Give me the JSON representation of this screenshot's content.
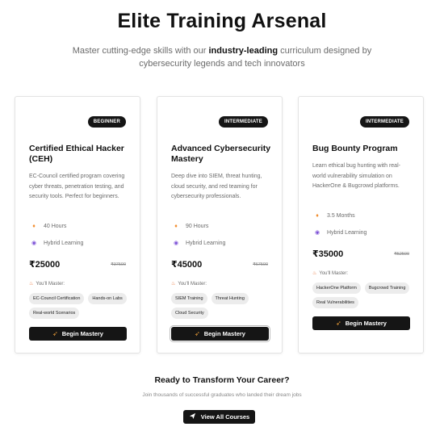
{
  "header": {
    "title": "Elite Training Arsenal",
    "subtitle_pre": "Master cutting-edge skills with our ",
    "subtitle_bold": "industry-leading",
    "subtitle_post": " curriculum designed by cybersecurity legends and tech innovators"
  },
  "cards": [
    {
      "badge": "BEGINNER",
      "title": "Certified Ethical Hacker (CEH)",
      "description": "EC-Council certified program covering cyber threats, penetration testing, and security tools. Perfect for beginners.",
      "duration_icon": "flame-icon",
      "duration": "40 Hours",
      "mode_icon": "globe-icon",
      "mode": "Hybrid Learning",
      "price": "₹25000",
      "old_price": "₹37500",
      "master_label": "You'll Master:",
      "skills": [
        "EC-Council Certification",
        "Hands-on Labs",
        "Real-world Scenarios"
      ],
      "cta_label": "Begin Mastery"
    },
    {
      "badge": "INTERMEDIATE",
      "title": "Advanced Cybersecurity Mastery",
      "description": "Deep dive into SIEM, threat hunting, cloud security, and red teaming for cybersecurity professionals.",
      "duration_icon": "flame-icon",
      "duration": "90 Hours",
      "mode_icon": "globe-icon",
      "mode": "Hybrid Learning",
      "price": "₹45000",
      "old_price": "₹67500",
      "master_label": "You'll Master:",
      "skills": [
        "SIEM Training",
        "Threat Hunting",
        "Cloud Security"
      ],
      "cta_label": "Begin Mastery"
    },
    {
      "badge": "INTERMEDIATE",
      "title": "Bug Bounty Program",
      "description": "Learn ethical bug hunting with real-world vulnerability simulation on HackerOne & Bugcrowd platforms.",
      "duration_icon": "flame-icon",
      "duration": "3.5 Months",
      "mode_icon": "globe-icon",
      "mode": "Hybrid Learning",
      "price": "₹35000",
      "old_price": "₹52500",
      "master_label": "You'll Master:",
      "skills": [
        "HackerOne Platform",
        "Bugcrowd Training",
        "Real Vulnerabilities"
      ],
      "cta_label": "Begin Mastery"
    }
  ],
  "footer": {
    "heading": "Ready to Transform Your Career?",
    "subtext": "Join thousands of successful graduates who landed their dream jobs",
    "button_label": "View All Courses",
    "button_icon": "paper-plane-icon"
  },
  "colors": {
    "dark": "#151515",
    "accent": "#f2a23a",
    "muted": "#6a6a6a",
    "tag_bg": "#ececec"
  }
}
